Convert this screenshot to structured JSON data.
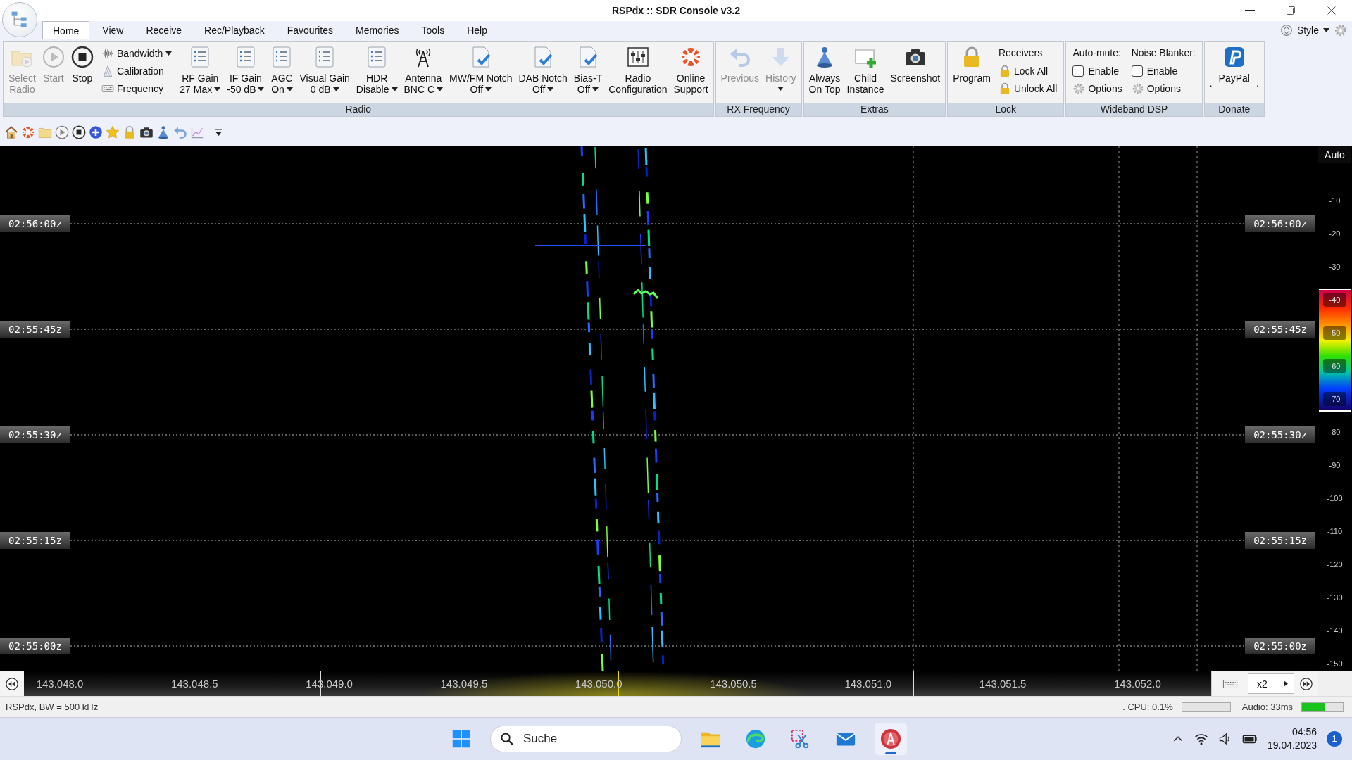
{
  "window": {
    "title": "RSPdx :: SDR Console v3.2"
  },
  "tabs": [
    {
      "label": "Home",
      "selected": true
    },
    {
      "label": "View",
      "selected": false
    },
    {
      "label": "Receive",
      "selected": false
    },
    {
      "label": "Rec/Playback",
      "selected": false
    },
    {
      "label": "Favourites",
      "selected": false
    },
    {
      "label": "Memories",
      "selected": false
    },
    {
      "label": "Tools",
      "selected": false
    },
    {
      "label": "Help",
      "selected": false
    }
  ],
  "style_menu": {
    "label": "Style"
  },
  "ribbon_groups": [
    {
      "label": "Radio",
      "items": [
        {
          "kind": "large",
          "lines": [
            "Select",
            "Radio"
          ],
          "disabled": true
        },
        {
          "kind": "large",
          "lines": [
            "Start"
          ],
          "disabled": true
        },
        {
          "kind": "large",
          "lines": [
            "Stop"
          ],
          "disabled": false
        },
        {
          "kind": "stack",
          "entries": [
            {
              "kind": "button",
              "label": "Bandwidth",
              "has_menu": true
            },
            {
              "kind": "button",
              "label": "Calibration",
              "has_menu": false
            },
            {
              "kind": "button",
              "label": "Frequency",
              "has_menu": false
            }
          ]
        },
        {
          "kind": "dropdown",
          "label": "RF Gain",
          "value": "27 Max"
        },
        {
          "kind": "dropdown",
          "label": "IF Gain",
          "value": "-50 dB"
        },
        {
          "kind": "dropdown",
          "label": "AGC",
          "value": "On"
        },
        {
          "kind": "dropdown",
          "label": "Visual Gain",
          "value": "0 dB"
        },
        {
          "kind": "dropdown",
          "label": "HDR",
          "value": "Disable"
        },
        {
          "kind": "dropdown",
          "label": "Antenna",
          "value": "BNC C"
        },
        {
          "kind": "dropdown",
          "label": "MW/FM Notch",
          "value": "Off"
        },
        {
          "kind": "dropdown",
          "label": "DAB Notch",
          "value": "Off"
        },
        {
          "kind": "dropdown",
          "label": "Bias-T",
          "value": "Off"
        },
        {
          "kind": "large",
          "lines": [
            "Radio",
            "Configuration"
          ],
          "disabled": false
        },
        {
          "kind": "large",
          "lines": [
            "Online",
            "Support"
          ],
          "disabled": false
        }
      ]
    },
    {
      "label": "RX Frequency",
      "items": [
        {
          "kind": "large",
          "lines": [
            "Previous"
          ],
          "disabled": true
        },
        {
          "kind": "large-menu",
          "lines": [
            "History"
          ],
          "disabled": true
        }
      ]
    },
    {
      "label": "Extras",
      "items": [
        {
          "kind": "large",
          "lines": [
            "Always",
            "On Top"
          ],
          "disabled": false
        },
        {
          "kind": "large",
          "lines": [
            "Child",
            "Instance"
          ],
          "disabled": false
        },
        {
          "kind": "large",
          "lines": [
            "Screenshot"
          ],
          "disabled": false
        }
      ]
    },
    {
      "label": "Lock",
      "items": [
        {
          "kind": "large",
          "lines": [
            "Program"
          ],
          "disabled": false
        },
        {
          "kind": "stack",
          "entries": [
            {
              "kind": "heading",
              "label": "Receivers"
            },
            {
              "kind": "button",
              "label": "Lock All",
              "has_menu": false
            },
            {
              "kind": "button",
              "label": "Unlock All",
              "has_menu": false
            }
          ]
        }
      ]
    },
    {
      "label": "Wideband DSP",
      "items": [
        {
          "kind": "checkcol",
          "heading": "Auto-mute:",
          "checkbox": {
            "label": "Enable",
            "checked": false
          },
          "options": "Options"
        },
        {
          "kind": "checkcol",
          "heading": "Noise Blanker:",
          "checkbox": {
            "label": "Enable",
            "checked": false
          },
          "options": "Options"
        }
      ]
    },
    {
      "label": "Donate",
      "items": [
        {
          "kind": "text",
          "text": "."
        },
        {
          "kind": "large",
          "lines": [
            "PayPal"
          ],
          "disabled": false
        },
        {
          "kind": "text",
          "text": "."
        }
      ]
    }
  ],
  "waterfall": {
    "time_rows": [
      {
        "left": "02:56:00z",
        "right": "02:56:00z"
      },
      {
        "left": "02:55:45z",
        "right": "02:55:45z"
      },
      {
        "left": "02:55:30z",
        "right": "02:55:30z"
      },
      {
        "left": "02:55:15z",
        "right": "02:55:15z"
      },
      {
        "left": "02:55:00z",
        "right": "02:55:00z"
      }
    ],
    "scale": {
      "mode": "Auto",
      "ticks": [
        {
          "label": "-10",
          "kind": "plain"
        },
        {
          "label": "-20",
          "kind": "plain"
        },
        {
          "label": "-30",
          "kind": "plain"
        },
        {
          "label": "-40",
          "kind": "band"
        },
        {
          "label": "-50",
          "kind": "band"
        },
        {
          "label": "-60",
          "kind": "band"
        },
        {
          "label": "-70",
          "kind": "band"
        },
        {
          "label": "-80",
          "kind": "plain"
        },
        {
          "label": "-90",
          "kind": "plain"
        },
        {
          "label": "-100",
          "kind": "plain"
        },
        {
          "label": "-110",
          "kind": "plain"
        },
        {
          "label": "-120",
          "kind": "plain"
        },
        {
          "label": "-130",
          "kind": "plain"
        },
        {
          "label": "-140",
          "kind": "plain"
        },
        {
          "label": "-150",
          "kind": "plain"
        }
      ]
    }
  },
  "frequency_bar": {
    "labels": [
      "143.048.0",
      "143.048.5",
      "143.049.0",
      "143.049.5",
      "143.050.0",
      "143.050.5",
      "143.051.0",
      "143.051.5",
      "143.052.0"
    ],
    "zoom": "x2"
  },
  "status_bar": {
    "info": "RSPdx, BW = 500 kHz",
    "cpu": {
      "label": ". CPU: 0.1%",
      "level": 0.001
    },
    "audio": {
      "label": "Audio: 33ms",
      "level": 0.55
    }
  },
  "taskbar": {
    "search": {
      "placeholder": "Suche"
    },
    "apps": [
      {
        "active": false
      },
      {
        "active": false
      },
      {
        "active": false
      },
      {
        "active": false
      },
      {
        "active": true
      }
    ],
    "time": "04:56",
    "date": "19.04.2023",
    "notifications": "1"
  }
}
